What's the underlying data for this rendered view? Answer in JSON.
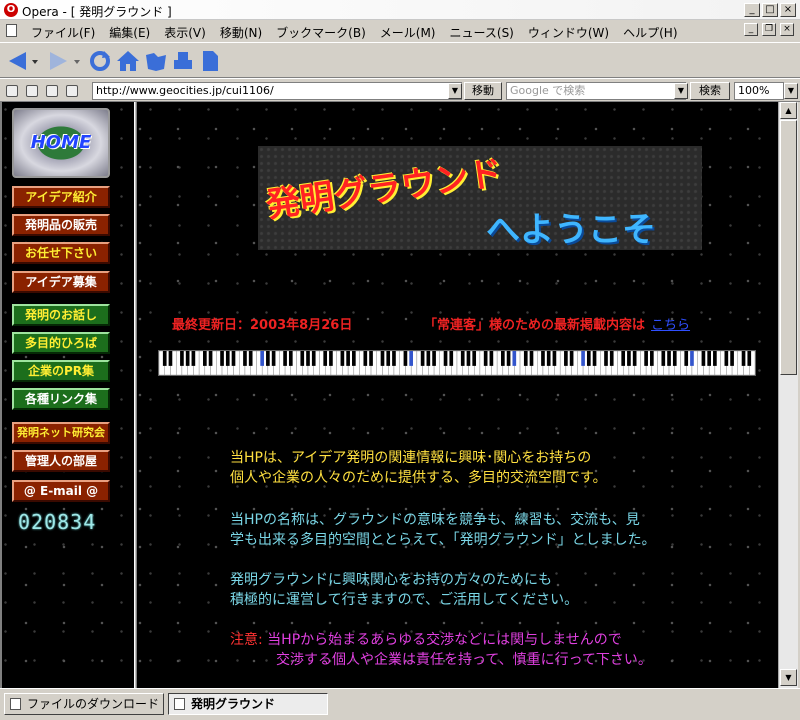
{
  "window": {
    "title": "Opera - [ 発明グラウンド ]"
  },
  "menu": {
    "items": [
      "ファイル(F)",
      "編集(E)",
      "表示(V)",
      "移動(N)",
      "ブックマーク(B)",
      "メール(M)",
      "ニュース(S)",
      "ウィンドウ(W)",
      "ヘルプ(H)"
    ]
  },
  "address": {
    "url": "http://www.geocities.jp/cui1106/",
    "go_label": "移動",
    "search_placeholder": "Google で検索",
    "search_label": "検索",
    "zoom": "100%"
  },
  "leftnav": {
    "home_label": "HOME",
    "items": [
      {
        "label": "アイデア紹介"
      },
      {
        "label": "発明品の販売"
      },
      {
        "label": "お任せ下さい"
      },
      {
        "label": "アイデア募集"
      },
      {
        "label": "発明のお話し"
      },
      {
        "label": "多目的ひろば"
      },
      {
        "label": "企業のPR集"
      },
      {
        "label": "各種リンク集"
      },
      {
        "label": "発明ネット研究会"
      },
      {
        "label": "管理人の部屋"
      },
      {
        "label": "@ E-mail @"
      }
    ],
    "counter": "020834"
  },
  "main": {
    "banner_line1": "発明グラウンド",
    "banner_line2": "へようこそ",
    "update": "最終更新日：2003年8月26日",
    "regular": "「常連客」様のための最新掲載内容は",
    "regular_link": "こちら",
    "p1_line1": "当HPは、アイデア発明の関連情報に興味･関心をお持ちの",
    "p1_line2": "個人や企業の人々のために提供する、多目的交流空間です。",
    "p2_line1": "当HPの名称は、グラウンドの意味を競争も、練習も、交流も、見",
    "p2_line2": "学も出来る多目的空間ととらえて、「発明グラウンド」としました。",
    "p3_line1": "発明グラウンドに興味関心をお持の方々のためにも",
    "p3_line2": "積極的に運営して行きますので、ご活用してください。",
    "p4_warn": "注意:",
    "p4_line1": "当HPから始まるあらゆる交渉などには関与しませんので",
    "p4_line2": "交渉する個人や企業は責任を持って、慎重に行って下さい。"
  },
  "tabs": {
    "download": "ファイルのダウンロード",
    "page": "発明グラウンド"
  },
  "colors": {
    "nav_red": "#8a2200",
    "nav_green": "#1c6e1c",
    "text_yellow": "#ffe040",
    "text_cyan": "#7ad6e6",
    "text_magenta": "#e040e0",
    "warn_red": "#ee2222"
  }
}
